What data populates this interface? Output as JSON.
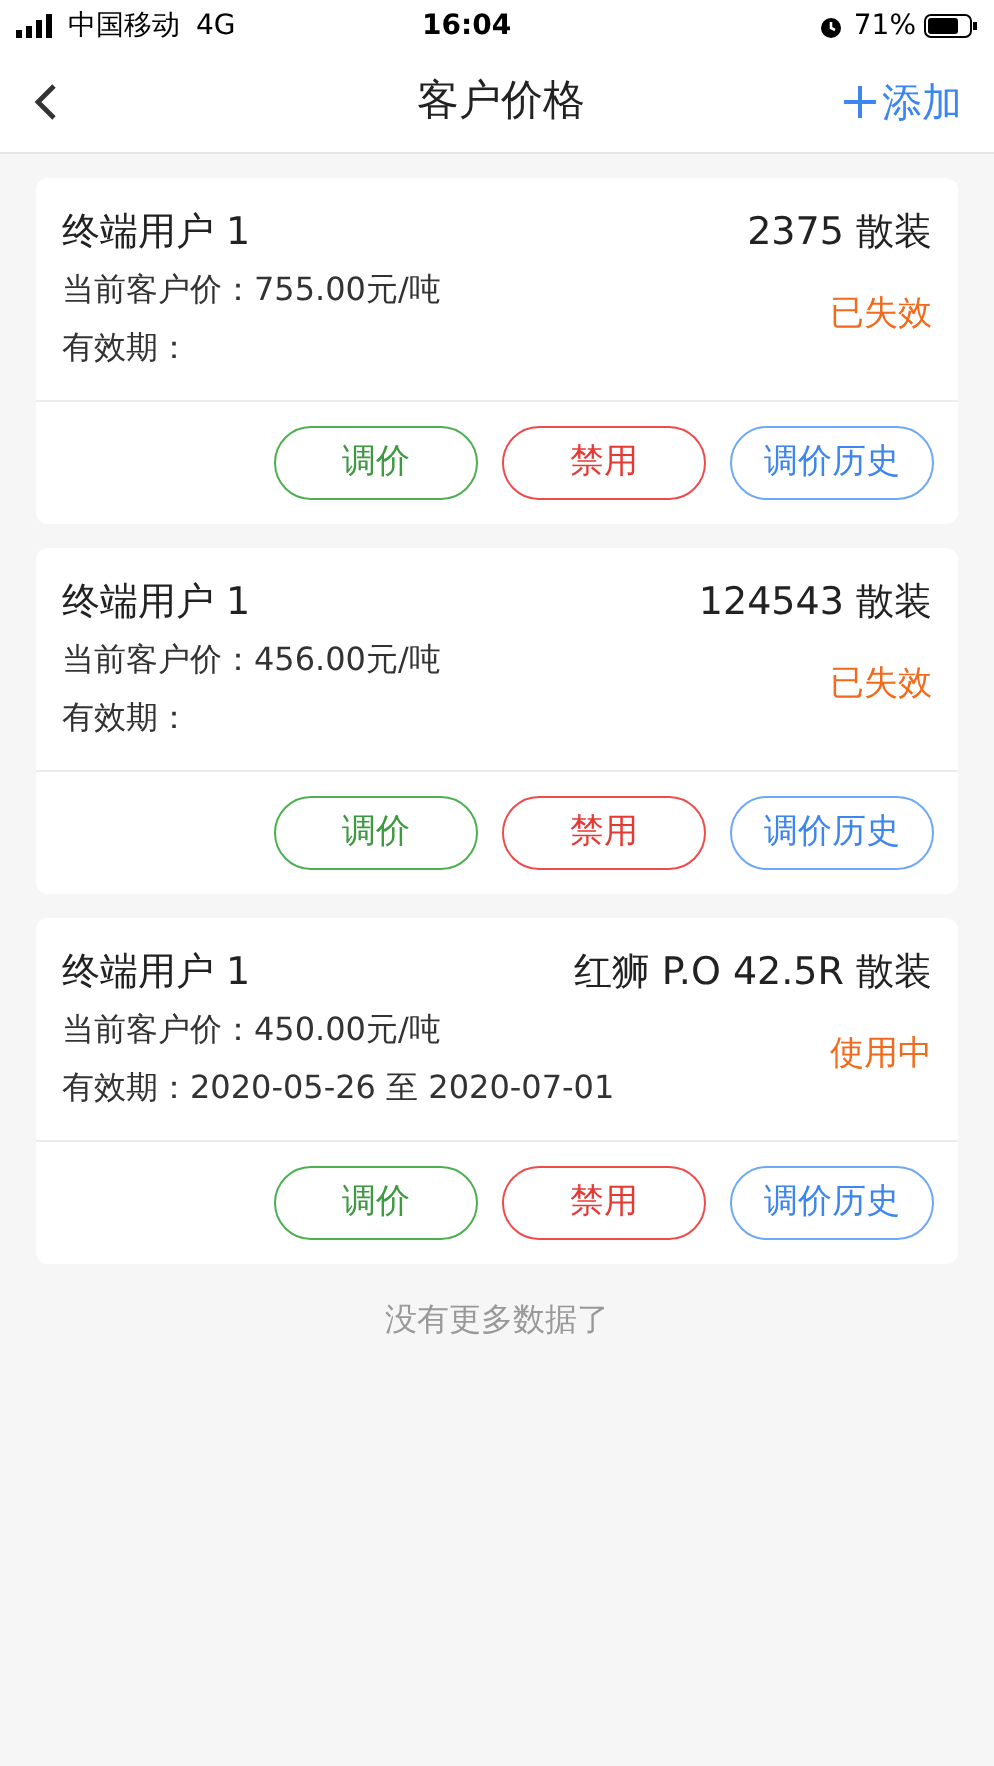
{
  "status_bar": {
    "carrier": "中国移动",
    "network": "4G",
    "time": "16:04",
    "battery": "71%"
  },
  "nav": {
    "title": "客户价格",
    "action": "添加"
  },
  "cards": [
    {
      "customer": "终端用户 1",
      "product": "2375 散装",
      "price": "当前客户价：755.00元/吨",
      "validity": "有效期：",
      "status": "已失效",
      "buttons": [
        {
          "kind": "green",
          "label": "调价"
        },
        {
          "kind": "red",
          "label": "禁用"
        },
        {
          "kind": "blue",
          "label": "调价历史"
        }
      ]
    },
    {
      "customer": "终端用户 1",
      "product": "124543 散装",
      "price": "当前客户价：456.00元/吨",
      "validity": "有效期：",
      "status": "已失效",
      "buttons": [
        {
          "kind": "green",
          "label": "调价"
        },
        {
          "kind": "red",
          "label": "禁用"
        },
        {
          "kind": "blue",
          "label": "调价历史"
        }
      ]
    },
    {
      "customer": "终端用户 1",
      "product": "红狮 P.O 42.5R 散装",
      "price": "当前客户价：450.00元/吨",
      "validity": "有效期：2020-05-26 至 2020-07-01",
      "status": "使用中",
      "buttons": [
        {
          "kind": "green",
          "label": "调价"
        },
        {
          "kind": "red",
          "label": "禁用"
        },
        {
          "kind": "blue",
          "label": "调价历史"
        }
      ]
    }
  ],
  "footer": "没有更多数据了"
}
